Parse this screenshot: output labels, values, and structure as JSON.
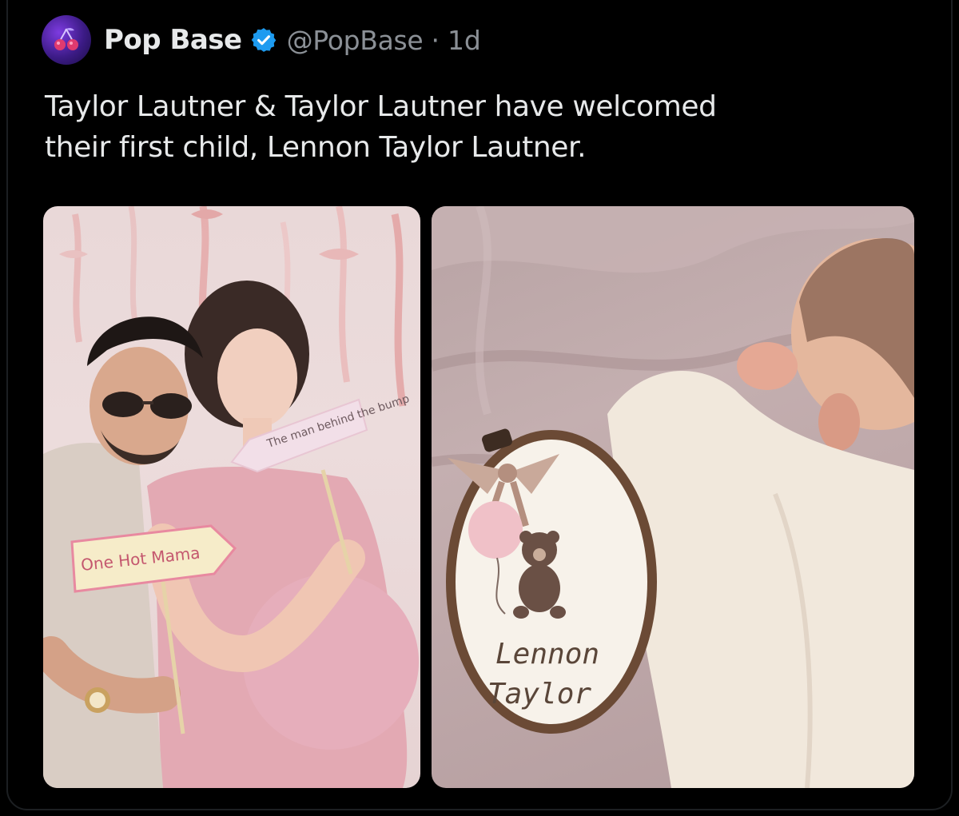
{
  "post": {
    "author": {
      "display_name": "Pop Base",
      "handle": "@PopBase",
      "separator": "·",
      "time": "1d",
      "verified": true,
      "avatar_icon": "cherry-logo-icon",
      "verified_icon": "verified-badge-icon"
    },
    "text": "Taylor Lautner & Taylor Lautner have welcomed\ntheir first child, Lennon Taylor Lautner.",
    "media": {
      "left_photo": {
        "sign_right": "The man behind the bump",
        "sign_left": "One Hot Mama"
      },
      "right_photo": {
        "hoop_line1": "Lennon",
        "hoop_line2": "Taylor"
      }
    }
  },
  "colors": {
    "background": "#000000",
    "text_primary": "#e7e9ea",
    "text_secondary": "#8b9096",
    "verified_blue": "#1d9bf0",
    "avatar_purple": "#5a2bb8"
  }
}
